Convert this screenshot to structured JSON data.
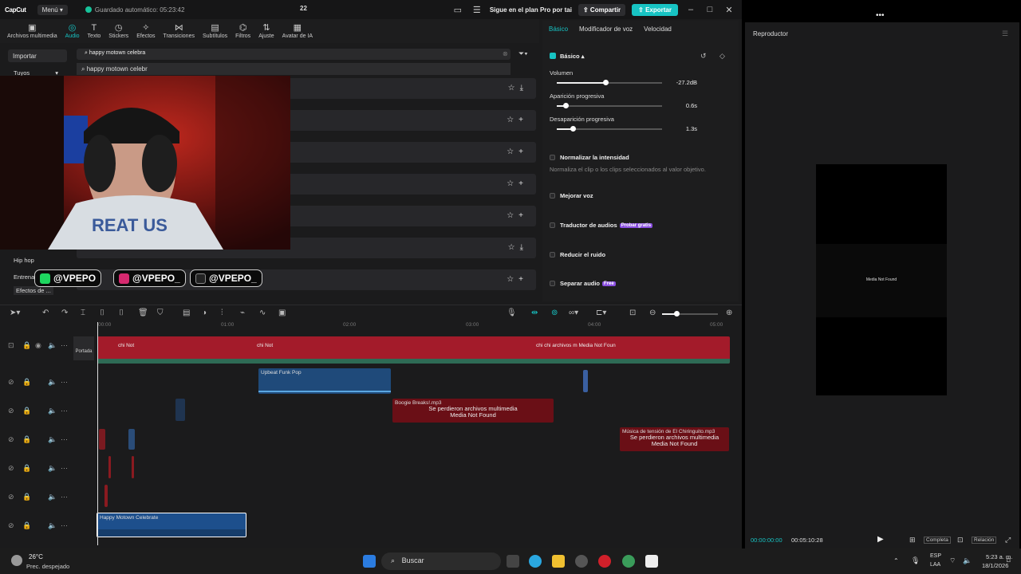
{
  "app": {
    "logo": "CapCut",
    "menu": "Menú",
    "autosave": "Guardado automático: 05:23:42",
    "project_num": "22",
    "pro_text": "Sigue en el plan Pro por tai",
    "share": "Compartir",
    "export": "Exportar"
  },
  "toolbar": [
    {
      "label": "Archivos multimedia",
      "icon": "media-icon"
    },
    {
      "label": "Audio",
      "icon": "audio-icon"
    },
    {
      "label": "Texto",
      "icon": "text-icon"
    },
    {
      "label": "Stickers",
      "icon": "sticker-icon"
    },
    {
      "label": "Efectos",
      "icon": "effects-icon"
    },
    {
      "label": "Transiciones",
      "icon": "transitions-icon"
    },
    {
      "label": "Subtítulos",
      "icon": "subtitles-icon"
    },
    {
      "label": "Filtros",
      "icon": "filters-icon"
    },
    {
      "label": "Ajuste",
      "icon": "adjust-icon"
    },
    {
      "label": "Avatar de IA",
      "icon": "avatar-icon"
    }
  ],
  "leftnav": {
    "import": "Importar",
    "yours": "Tuyos",
    "hiphop": "Hip hop",
    "entret": "Entrena",
    "efectos": "Efectos de ..."
  },
  "search": {
    "value": "happy motown celebra",
    "suggestion": "happy motown celebr"
  },
  "overlay": {
    "social1": "@VPEPO",
    "social2": "@VPEPO_",
    "social3": "@VPEPO_"
  },
  "right": {
    "tab1": "Básico",
    "tab2": "Modificador de voz",
    "tab3": "Velocidad",
    "section": "Básico",
    "volume": "Volumen",
    "volume_val": "-27.2dB",
    "fadein": "Aparición progresiva",
    "fadein_val": "0.6s",
    "fadeout": "Desaparición progresiva",
    "fadeout_val": "1.3s",
    "normalize": "Normalizar la intensidad",
    "normalize_desc": "Normaliza el clip o los clips seleccionados al valor objetivo.",
    "enhance": "Mejorar voz",
    "translate": "Traductor de audios",
    "translate_badge": "Probar gratis",
    "reduce": "Reducir el ruido",
    "separate": "Separar audio",
    "separate_badge": "Free",
    "volume_level": 0.46,
    "fadein_level": 0.08,
    "fadeout_level": 0.15
  },
  "ruler": [
    "00:00",
    "01:00",
    "02:00",
    "03:00",
    "04:00",
    "05:00"
  ],
  "timeline": {
    "cover": "Portada",
    "clip_funk": "Upbeat Funk Pop",
    "clip_boogie": "Boogie Breaks!.mp3",
    "lost1": "Se perdieron archivos multimedia",
    "lost2": "Media Not Found",
    "clip_tension": "Música de tensión de El Chiringuito.mp3",
    "clip_happy": "Happy Motown Celebrate",
    "tiny": "chi Not",
    "tiny2": "chi chi archivos m Media Not Foun",
    "tiny3": "Not Found"
  },
  "player": {
    "title": "Reproductor",
    "media_nf": "Media Not Found",
    "time_cur": "00:00:00:00",
    "time_total": "00:05:10:28",
    "full": "Completa",
    "ratio": "Relación"
  },
  "taskbar": {
    "temp": "26°C",
    "weather": "Prec. despejado",
    "search": "Buscar",
    "lang1": "ESP",
    "lang2": "LAA",
    "time": "5:23 a. m.",
    "date": "18/1/2026"
  }
}
